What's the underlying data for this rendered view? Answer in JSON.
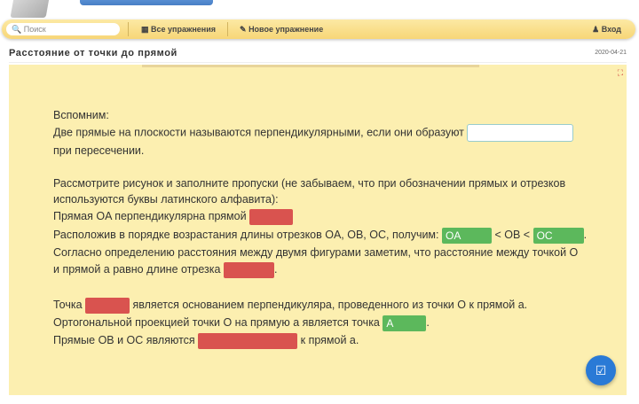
{
  "nav": {
    "search_placeholder": "Поиск",
    "all_exercises": "Все упражнения",
    "new_exercise": "Новое упражнение",
    "login": "Вход"
  },
  "page": {
    "title": "Расстояние от точки до прямой",
    "date": "2020-04-21"
  },
  "content": {
    "l1": "Вспомним:",
    "l2": "Две прямые на плоскости называются перпендикулярными, если они образуют",
    "l3": "при пересечении.",
    "l4": "Рассмотрите рисунок и заполните пропуски (не забываем, что при обозначении прямых и отрезков",
    "l5": "используются буквы латинского алфавита):",
    "l6": "Прямая OA перпендикулярна прямой",
    "l7a": "Расположив в порядке возрастания длины отрезков OA, OB, OC, получим:",
    "l7b": "< OB <",
    "l8": "Согласно определению расстояния между двумя фигурами заметим, что расстояние между точкой O",
    "l9": "и прямой a равно длине отрезка",
    "l10a": "Точка",
    "l10b": "является основанием перпендикуляра, проведенного из точки O к прямой a.",
    "l11": "Ортогональной проекцией точки O на прямую a является точка",
    "l12a": "Прямые OB и OC являются",
    "l12b": "к прямой a.",
    "dot": "."
  },
  "answers": {
    "oa": "OA",
    "oc": "OC",
    "a": "A"
  },
  "colors": {
    "correct": "#5cb85c",
    "wrong": "#d9534f",
    "nav": "#f7d677",
    "content_bg": "#fcefb0",
    "check_button": "#2a7ad6"
  }
}
